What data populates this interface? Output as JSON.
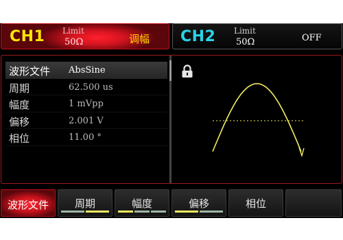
{
  "channel1": {
    "name": "CH1",
    "limit_label": "Limit",
    "impedance": "50Ω",
    "mode": "调幅",
    "accent_color": "#ffe600"
  },
  "channel2": {
    "name": "CH2",
    "limit_label": "Limit",
    "impedance": "50Ω",
    "status": "OFF",
    "accent_color": "#29d3e6"
  },
  "params": [
    {
      "label": "波形文件",
      "value": "AbsSine",
      "selected": true
    },
    {
      "label": "周期",
      "value": "62.500 us",
      "selected": false
    },
    {
      "label": "幅度",
      "value": "1 mVpp",
      "selected": false
    },
    {
      "label": "偏移",
      "value": "2.001 V",
      "selected": false
    },
    {
      "label": "相位",
      "value": "11.00 °",
      "selected": false
    }
  ],
  "waveform": {
    "shape": "half-sine",
    "trace_color": "#f2ee62",
    "icon": "lock-icon"
  },
  "softkeys": [
    {
      "label": "波形文件",
      "active": true
    },
    {
      "label": "周期",
      "active": false
    },
    {
      "label": "幅度",
      "active": false
    },
    {
      "label": "偏移",
      "active": false
    },
    {
      "label": "相位",
      "active": false
    },
    {
      "label": "",
      "active": false
    }
  ]
}
